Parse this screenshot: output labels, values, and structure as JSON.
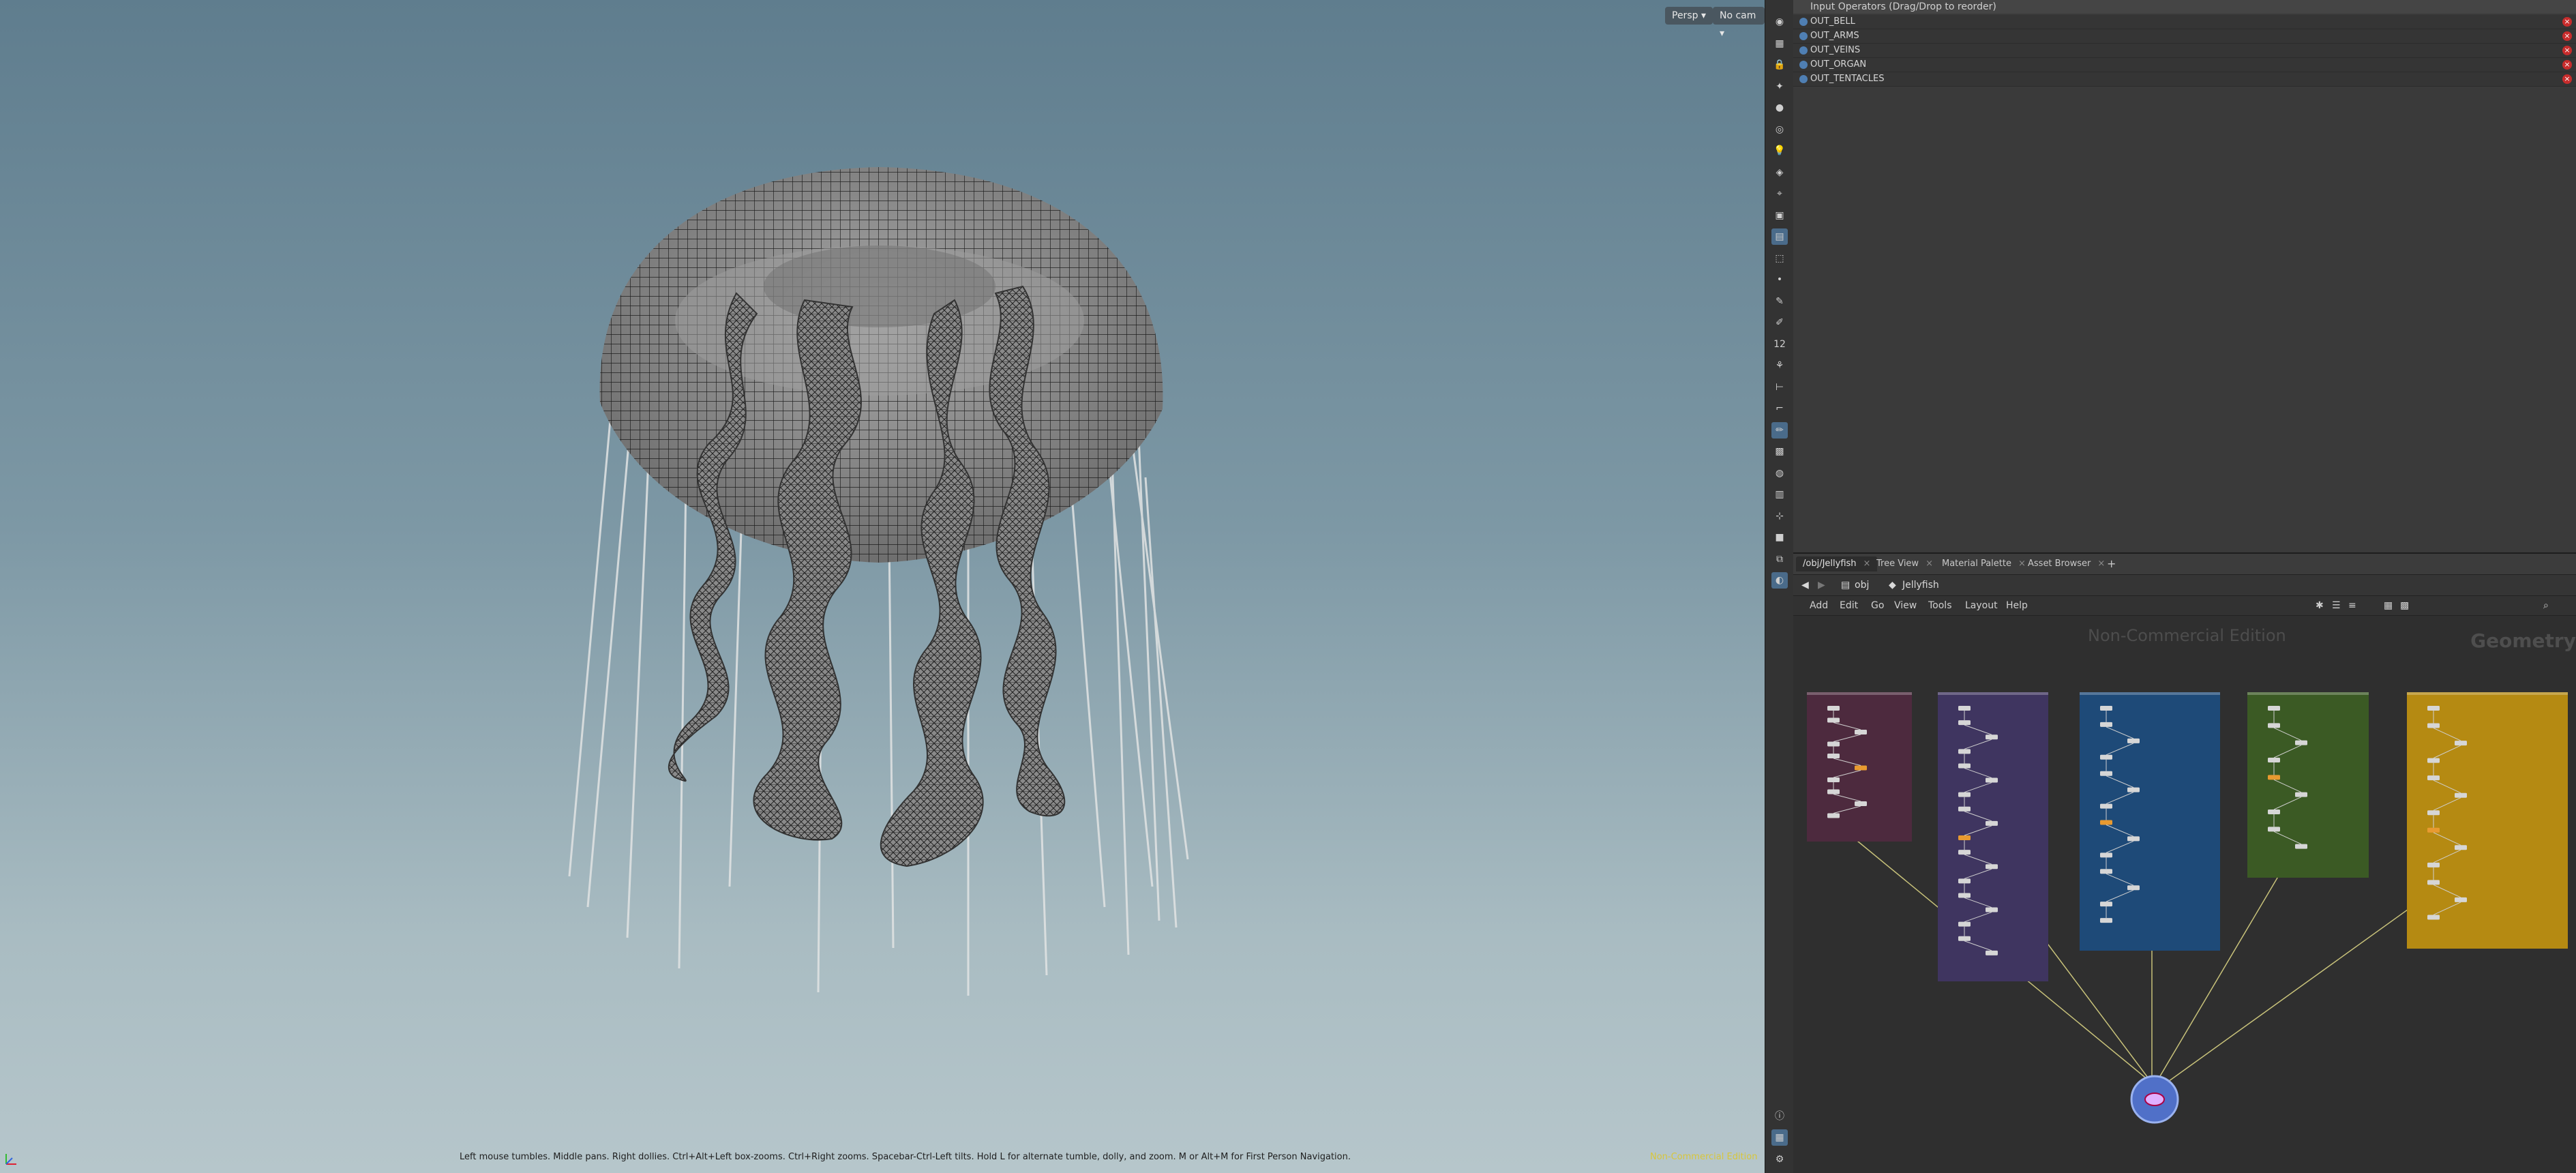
{
  "viewport": {
    "persp_label": "Persp ▾",
    "cam_label": "No cam ▾",
    "status_text": "Left mouse tumbles. Middle pans. Right dollies. Ctrl+Alt+Left box-zooms. Ctrl+Right zooms. Spacebar-Ctrl-Left tilts. Hold L for alternate tumble, dolly, and zoom.     M or Alt+M for First Person Navigation.",
    "nc_label": "Non-Commercial Edition"
  },
  "shelf": {
    "tools": [
      "view-icon",
      "select-icon",
      "lock-icon",
      "pose-icon",
      "sphere-icon",
      "handle-icon",
      "light-icon",
      "camera-icon",
      "snap-icon",
      "grid-icon",
      "display-icon",
      "wire-icon",
      "point-icon",
      "brush-icon",
      "pen-icon",
      "number-icon",
      "particle-icon",
      "measure-icon",
      "edge-icon",
      "paint-icon",
      "texture-icon",
      "shade-icon",
      "map-icon",
      "axis-icon",
      "box-icon",
      "group-icon",
      "pin-icon"
    ],
    "bottom_tools": [
      "info-icon",
      "layout-icon",
      "settings-icon"
    ]
  },
  "operators": {
    "header": "Input Operators (Drag/Drop to reorder)",
    "items": [
      "OUT_BELL",
      "OUT_ARMS",
      "OUT_VEINS",
      "OUT_ORGAN",
      "OUT_TENTACLES"
    ]
  },
  "network": {
    "tabs": [
      "/obj/Jellyfish",
      "Tree View",
      "Material Palette",
      "Asset Browser"
    ],
    "add_tab": "+",
    "path": {
      "root": "obj",
      "node": "Jellyfish"
    },
    "menu": [
      "Add",
      "Edit",
      "Go",
      "View",
      "Tools",
      "Layout",
      "Help"
    ],
    "watermark": "Non-Commercial Edition",
    "context_label": "Geometry",
    "colors": {
      "bell": "#4d2a3e",
      "arms": "#3f3560",
      "veins": "#1e4a78",
      "organ": "#3b5a24",
      "tentacles": "#b58a12",
      "output_node": "#5070c8"
    }
  }
}
